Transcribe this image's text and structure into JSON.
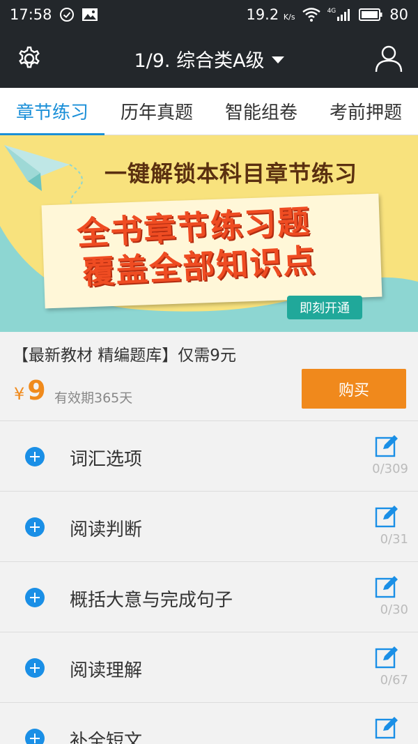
{
  "status_bar": {
    "time": "17:58",
    "speed": "19.2",
    "speed_unit": "K/s",
    "network": "4G",
    "battery": "80"
  },
  "app_bar": {
    "title": "1/9. 综合类A级"
  },
  "tabs": [
    {
      "label": "章节练习",
      "active": true
    },
    {
      "label": "历年真题",
      "active": false
    },
    {
      "label": "智能组卷",
      "active": false
    },
    {
      "label": "考前押题",
      "active": false
    }
  ],
  "banner": {
    "headline": "一键解锁本科目章节练习",
    "line1": "全书章节练习题",
    "line2": "覆盖全部知识点",
    "cta": "即刻开通"
  },
  "promo": {
    "text": "【最新教材 精编题库】仅需9元",
    "price_symbol": "¥",
    "price_value": "9",
    "validity": "有效期365天",
    "buy_label": "购买"
  },
  "chapters": [
    {
      "title": "词汇选项",
      "count": "0/309"
    },
    {
      "title": "阅读判断",
      "count": "0/31"
    },
    {
      "title": "概括大意与完成句子",
      "count": "0/30"
    },
    {
      "title": "阅读理解",
      "count": "0/67"
    },
    {
      "title": "补全短文",
      "count": ""
    }
  ],
  "colors": {
    "accent": "#1a8fd8",
    "orange": "#f0891c",
    "dark_bar": "#23272b",
    "banner_bg": "#f8e27d",
    "teal": "#20a89a"
  }
}
